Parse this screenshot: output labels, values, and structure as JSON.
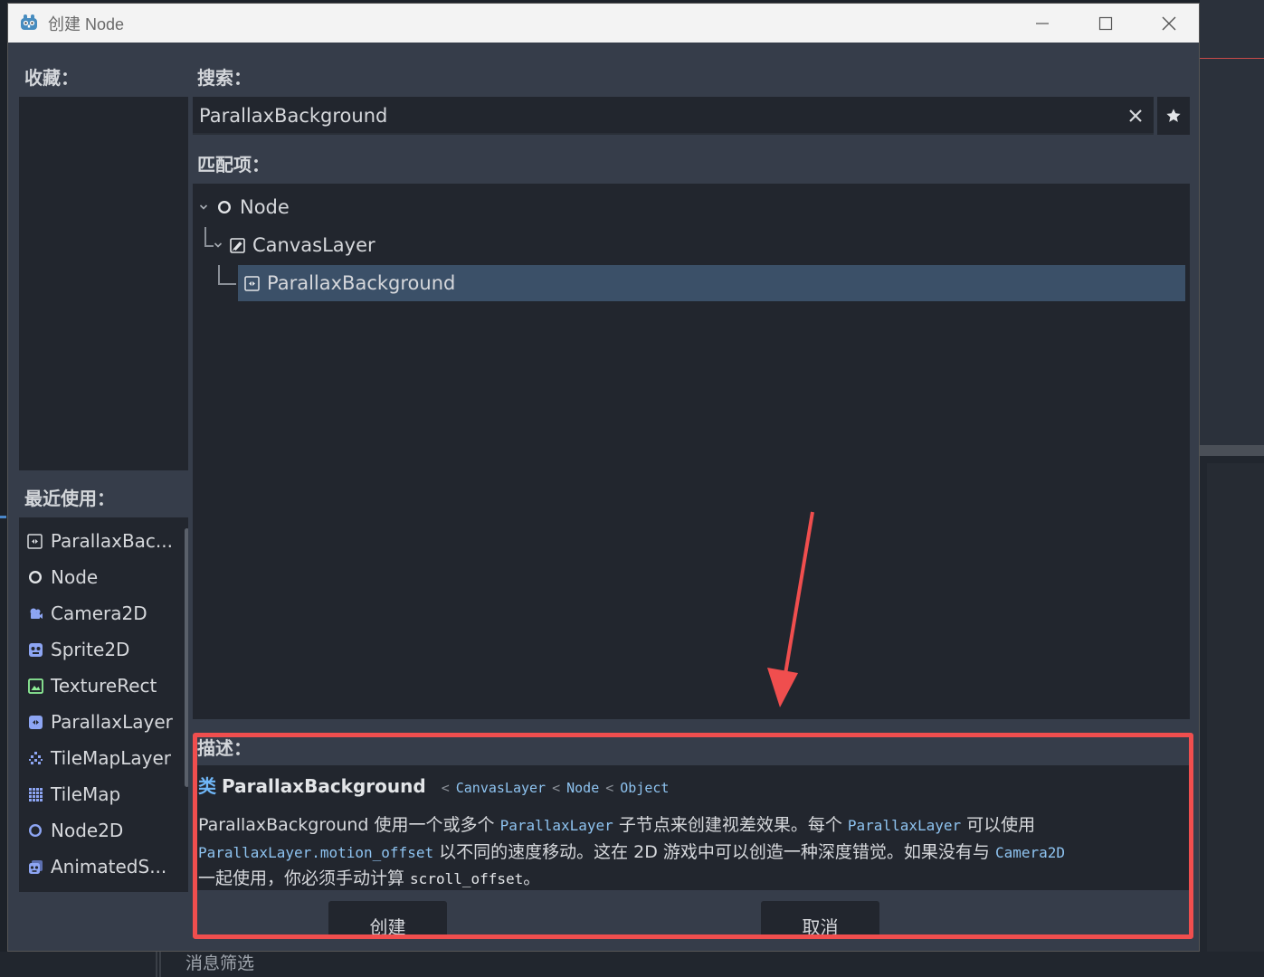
{
  "window": {
    "title": "创建 Node",
    "minimize_glyph": "—",
    "close_glyph": "✕"
  },
  "favorites": {
    "label": "收藏："
  },
  "recent": {
    "label": "最近使用：",
    "items": [
      {
        "label": "ParallaxBac...",
        "icon": "parallax-background-icon"
      },
      {
        "label": "Node",
        "icon": "node-icon"
      },
      {
        "label": "Camera2D",
        "icon": "camera2d-icon"
      },
      {
        "label": "Sprite2D",
        "icon": "sprite2d-icon"
      },
      {
        "label": "TextureRect",
        "icon": "texture-rect-icon"
      },
      {
        "label": "ParallaxLayer",
        "icon": "parallax-layer-icon"
      },
      {
        "label": "TileMapLayer",
        "icon": "tilemap-layer-icon"
      },
      {
        "label": "TileMap",
        "icon": "tilemap-icon"
      },
      {
        "label": "Node2D",
        "icon": "node2d-icon"
      },
      {
        "label": "AnimatedS...",
        "icon": "animated-sprite-icon"
      }
    ]
  },
  "search": {
    "label": "搜索：",
    "value": "ParallaxBackground"
  },
  "matches": {
    "label": "匹配项：",
    "tree": [
      {
        "label": "Node",
        "icon": "node-icon",
        "expanded": true
      },
      {
        "label": "CanvasLayer",
        "icon": "canvas-layer-icon",
        "expanded": true
      },
      {
        "label": "ParallaxBackground",
        "icon": "parallax-background-icon",
        "selected": true
      }
    ]
  },
  "description": {
    "label": "描述：",
    "keyword": "类",
    "class_name": "ParallaxBackground",
    "inherits": [
      "CanvasLayer",
      "Node",
      "Object"
    ],
    "inherit_sep": "<",
    "text": {
      "p1": "ParallaxBackground 使用一个或多个 ",
      "c1": "ParallaxLayer",
      "p2": " 子节点来创建视差效果。每个 ",
      "c2": "ParallaxLayer",
      "p3": " 可以使用",
      "c3": "ParallaxLayer.motion_offset",
      "p4": " 以不同的速度移动。这在 2D 游戏中可以创造一种深度错觉。如果没有与 ",
      "c4": "Camera2D",
      "p5": "一起使用，你必须手动计算 ",
      "c5": "scroll_offset",
      "p6": "。"
    }
  },
  "buttons": {
    "create": "创建",
    "cancel": "取消"
  },
  "background": {
    "bottom_panel_text": "消息筛选"
  },
  "colors": {
    "window_bg": "#363d4a",
    "panel_bg": "#22262e",
    "selected_row": "#3b5068",
    "accent_blue": "#6fb6f7",
    "annotation_red": "#f04e4e"
  }
}
